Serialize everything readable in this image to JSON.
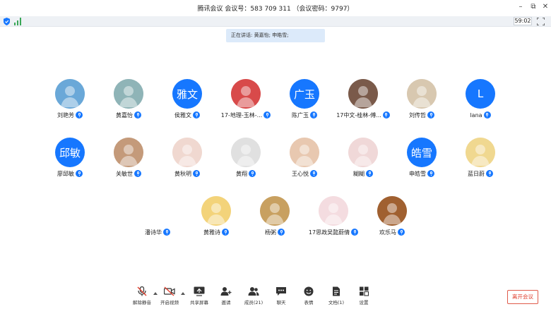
{
  "window": {
    "title": "腾讯会议  会议号：583 709 311  （会议密码：9797）",
    "controls": [
      "minimize-icon",
      "restore-icon",
      "close-icon"
    ]
  },
  "status": {
    "timer": "59:02",
    "icons": [
      "shield-icon",
      "signal-icon",
      "fullscreen-icon"
    ]
  },
  "speaking": {
    "text": "正在讲话: 黄嘉怡; 申皓雪;"
  },
  "participants": [
    {
      "name": "刘艳芳",
      "avatar_text": "",
      "avatar_kind": "photo",
      "color": "#6aa8d8"
    },
    {
      "name": "黄嘉怡",
      "avatar_text": "",
      "avatar_kind": "photo",
      "color": "#8fb4b7"
    },
    {
      "name": "侯雅文",
      "avatar_text": "雅文",
      "avatar_kind": "text",
      "color": "#1677ff"
    },
    {
      "name": "17-地理-玉林-...",
      "avatar_text": "",
      "avatar_kind": "photo",
      "color": "#d84a4a"
    },
    {
      "name": "陈广玉",
      "avatar_text": "广玉",
      "avatar_kind": "text",
      "color": "#1677ff"
    },
    {
      "name": "17中文-桂林-傅...",
      "avatar_text": "",
      "avatar_kind": "photo",
      "color": "#7a5a4a"
    },
    {
      "name": "刘传哲",
      "avatar_text": "",
      "avatar_kind": "photo",
      "color": "#d8c8b0"
    },
    {
      "name": "lana",
      "avatar_text": "L",
      "avatar_kind": "text",
      "color": "#1677ff"
    },
    {
      "name": "廖邱敏",
      "avatar_text": "邱敏",
      "avatar_kind": "text",
      "color": "#1677ff"
    },
    {
      "name": "关敏世",
      "avatar_text": "",
      "avatar_kind": "photo",
      "color": "#c49a7a"
    },
    {
      "name": "黄秋明",
      "avatar_text": "",
      "avatar_kind": "photo",
      "color": "#f0d8d0"
    },
    {
      "name": "黄翔",
      "avatar_text": "",
      "avatar_kind": "photo",
      "color": "#e0e0e0"
    },
    {
      "name": "王心悦",
      "avatar_text": "",
      "avatar_kind": "photo",
      "color": "#e8c8b0"
    },
    {
      "name": "糊糊",
      "avatar_text": "",
      "avatar_kind": "photo",
      "color": "#f0d8d8"
    },
    {
      "name": "申皓雪",
      "avatar_text": "皓雪",
      "avatar_kind": "text",
      "color": "#1677ff"
    },
    {
      "name": "蓝日蔚",
      "avatar_text": "",
      "avatar_kind": "photo",
      "color": "#f0d890"
    },
    {
      "name": "潘诗华",
      "avatar_text": "",
      "avatar_kind": "photo",
      "color": "#ffffff"
    },
    {
      "name": "黄雅诗",
      "avatar_text": "",
      "avatar_kind": "photo",
      "color": "#f3d37a"
    },
    {
      "name": "杨粥",
      "avatar_text": "",
      "avatar_kind": "photo",
      "color": "#c8a060"
    },
    {
      "name": "17思政吴懿蔚倩",
      "avatar_text": "",
      "avatar_kind": "photo",
      "color": "#f4dce0"
    },
    {
      "name": "欢乐马",
      "avatar_text": "",
      "avatar_kind": "photo",
      "color": "#a06030"
    }
  ],
  "toolbar": {
    "unmute": "解除静音",
    "video": "开启视频",
    "share": "共享屏幕",
    "invite": "邀请",
    "members": "成员(21)",
    "chat": "聊天",
    "emoji": "表情",
    "docs": "文档(1)",
    "settings": "设置",
    "leave": "离开会议"
  },
  "colors": {
    "accent": "#1677ff",
    "leave": "#e0402f",
    "speaking_bg": "#dceafa"
  }
}
